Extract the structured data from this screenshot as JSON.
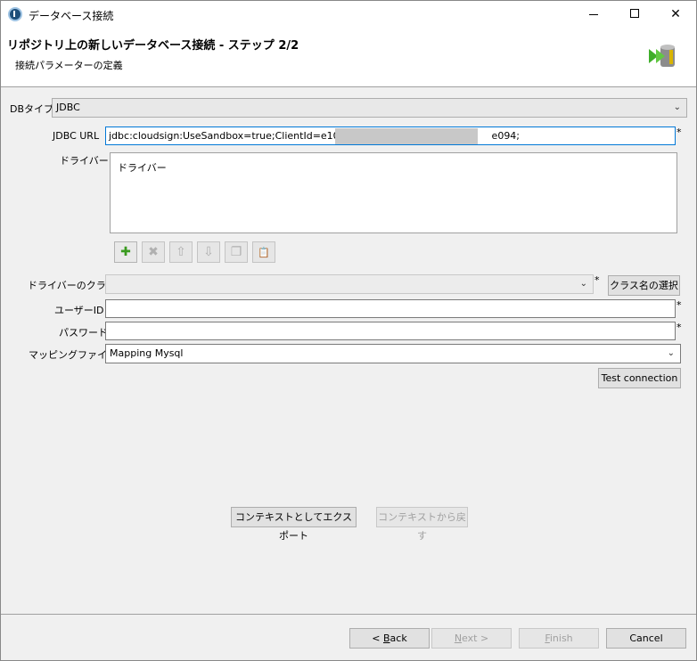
{
  "window": {
    "title": "データベース接続",
    "minimize": "—",
    "maximize": "☐",
    "close": "✕"
  },
  "header": {
    "title": "リポジトリ上の新しいデータベース接続 - ステップ 2/2",
    "subtitle": "接続パラメーターの定義",
    "icon": "database-arrow-icon"
  },
  "form": {
    "db_type_label": "DBタイプ",
    "db_type_value": "JDBC",
    "jdbc_url_label": "JDBC URL",
    "jdbc_url_value_start": "jdbc:cloudsign:UseSandbox=true;ClientId=e10f9",
    "jdbc_url_value_end": "e094;",
    "required_mark": "*",
    "driver_label": "ドライバー",
    "driver_items": [
      "ドライバー"
    ],
    "driver_class_label": "ドライバーのクラス",
    "driver_class_value": "",
    "select_class_button": "クラス名の選択",
    "user_id_label": "ユーザーID",
    "user_id_value": "",
    "password_label": "パスワード",
    "password_value": "",
    "mapping_label": "マッピングファイル",
    "mapping_value": "Mapping Mysql",
    "test_connection": "Test connection"
  },
  "toolbar": {
    "add": "✚",
    "remove": "✖",
    "up": "⇧",
    "down": "⇩",
    "copy": "❐",
    "paste": "📋"
  },
  "context": {
    "export": "コンテキストとしてエクスポート",
    "revert": "コンテキストから戻す"
  },
  "footer": {
    "back_prefix": "< ",
    "back_mnemonic": "B",
    "back_rest": "ack",
    "next_mnemonic": "N",
    "next_rest": "ext >",
    "finish_mnemonic": "F",
    "finish_rest": "inish",
    "cancel": "Cancel"
  }
}
